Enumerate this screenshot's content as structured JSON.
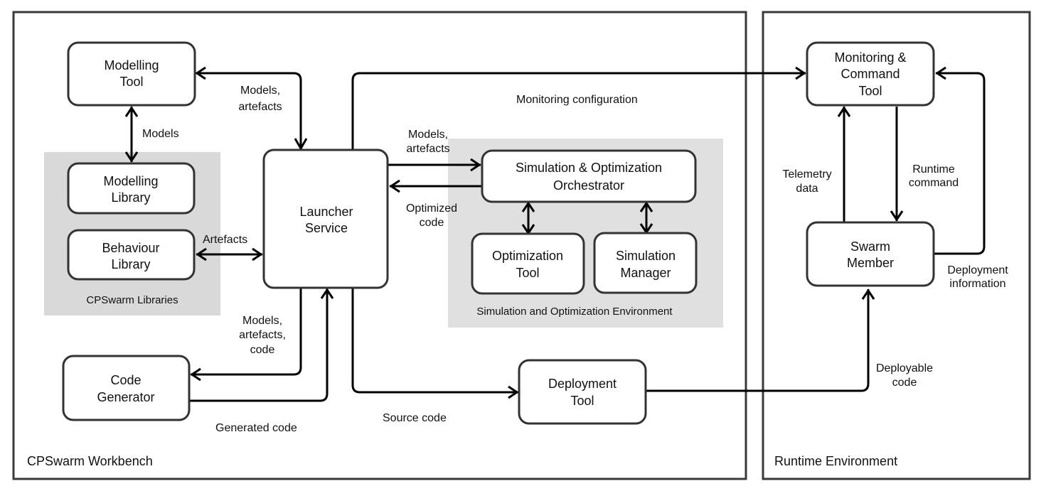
{
  "containers": {
    "workbench": "CPSwarm Workbench",
    "runtime": "Runtime Environment"
  },
  "groups": {
    "libraries": "CPSwarm Libraries",
    "sim_env": "Simulation and Optimization Environment"
  },
  "nodes": {
    "modelling_tool": [
      "Modelling",
      "Tool"
    ],
    "modelling_library": [
      "Modelling",
      "Library"
    ],
    "behaviour_library": [
      "Behaviour",
      "Library"
    ],
    "launcher_service": [
      "Launcher",
      "Service"
    ],
    "code_generator": [
      "Code",
      "Generator"
    ],
    "orchestrator": [
      "Simulation & Optimization",
      "Orchestrator"
    ],
    "optimization_tool": [
      "Optimization",
      "Tool"
    ],
    "simulation_manager": [
      "Simulation",
      "Manager"
    ],
    "deployment_tool": [
      "Deployment",
      "Tool"
    ],
    "monitoring_tool": [
      "Monitoring &",
      "Command",
      "Tool"
    ],
    "swarm_member": [
      "Swarm",
      "Member"
    ]
  },
  "edges": {
    "modelling_launcher": [
      "Models,",
      "artefacts"
    ],
    "modelling_library": [
      "Models"
    ],
    "behaviour_launcher": [
      "Artefacts"
    ],
    "launcher_orchestrator": [
      "Models,",
      "artefacts"
    ],
    "orchestrator_launcher": [
      "Optimized",
      "code"
    ],
    "launcher_monitoring": [
      "Monitoring configuration"
    ],
    "launcher_codegen": [
      "Models,",
      "artefacts,",
      "code"
    ],
    "codegen_launcher": [
      "Generated code"
    ],
    "launcher_deployment": [
      "Source code"
    ],
    "deployment_swarm": [
      "Deployable",
      "code"
    ],
    "swarm_monitoring_telemetry": [
      "Telemetry",
      "data"
    ],
    "monitoring_swarm_command": [
      "Runtime",
      "command"
    ],
    "swarm_monitoring_deploy": [
      "Deployment",
      "information"
    ]
  }
}
